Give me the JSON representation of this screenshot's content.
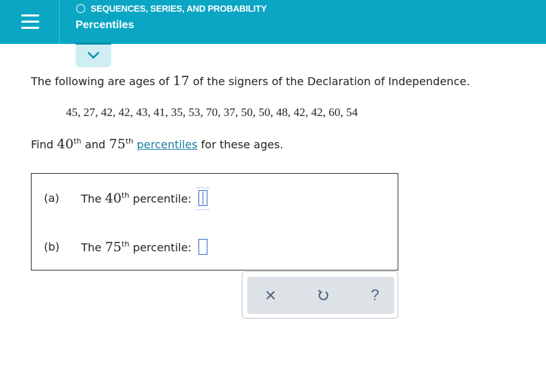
{
  "header": {
    "topic": "SEQUENCES, SERIES, AND PROBABILITY",
    "subtitle": "Percentiles"
  },
  "problem": {
    "intro_before": "The following are ages of ",
    "intro_count": "17",
    "intro_after": " of the signers of the Declaration of Independence.",
    "data": "45, 27, 42, 42, 43, 41, 35, 53, 70, 37, 50, 50, 48, 42, 42, 60, 54",
    "find_prefix": "Find ",
    "find_p1_num": "40",
    "find_p1_sup": "th",
    "find_mid": " and ",
    "find_p2_num": "75",
    "find_p2_sup": "th",
    "find_link": "percentiles",
    "find_suffix": " for these ages."
  },
  "answers": [
    {
      "part": "(a)",
      "label_before": "The ",
      "num": "40",
      "sup": "th",
      "label_after": " percentile:",
      "value": ""
    },
    {
      "part": "(b)",
      "label_before": "The ",
      "num": "75",
      "sup": "th",
      "label_after": " percentile:",
      "value": ""
    }
  ],
  "toolbar": {
    "clear_icon": "x-icon",
    "undo_icon": "undo-icon",
    "help_label": "?"
  },
  "colors": {
    "header_bg": "#0aa6c4",
    "link": "#1a7ca0",
    "input_border": "#2a66c9",
    "toolbar_bg": "#dde2e7"
  }
}
